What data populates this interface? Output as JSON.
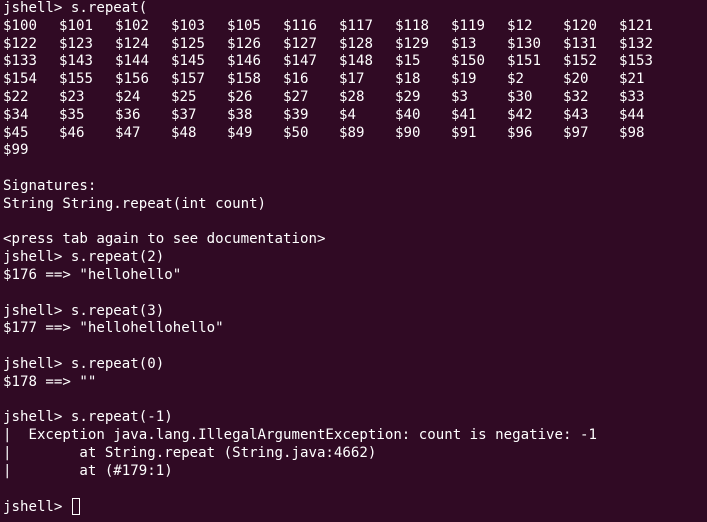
{
  "terminal": {
    "prompt_line": "jshell> s.repeat(",
    "completions": [
      [
        "$100",
        "$101",
        "$102",
        "$103",
        "$105",
        "$116",
        "$117",
        "$118",
        "$119",
        "$12",
        "$120",
        "$121"
      ],
      [
        "$122",
        "$123",
        "$124",
        "$125",
        "$126",
        "$127",
        "$128",
        "$129",
        "$13",
        "$130",
        "$131",
        "$132"
      ],
      [
        "$133",
        "$143",
        "$144",
        "$145",
        "$146",
        "$147",
        "$148",
        "$15",
        "$150",
        "$151",
        "$152",
        "$153"
      ],
      [
        "$154",
        "$155",
        "$156",
        "$157",
        "$158",
        "$16",
        "$17",
        "$18",
        "$19",
        "$2",
        "$20",
        "$21"
      ],
      [
        "$22",
        "$23",
        "$24",
        "$25",
        "$26",
        "$27",
        "$28",
        "$29",
        "$3",
        "$30",
        "$32",
        "$33"
      ],
      [
        "$34",
        "$35",
        "$36",
        "$37",
        "$38",
        "$39",
        "$4",
        "$40",
        "$41",
        "$42",
        "$43",
        "$44"
      ],
      [
        "$45",
        "$46",
        "$47",
        "$48",
        "$49",
        "$50",
        "$89",
        "$90",
        "$91",
        "$96",
        "$97",
        "$98"
      ],
      [
        "$99"
      ]
    ],
    "signatures_header": "Signatures:",
    "signature": "String String.repeat(int count)",
    "press_tab_hint": "<press tab again to see documentation>",
    "cmd1": "jshell> s.repeat(2)",
    "out1": "$176 ==> \"hellohello\"",
    "cmd2": "jshell> s.repeat(3)",
    "out2": "$177 ==> \"hellohellohello\"",
    "cmd3": "jshell> s.repeat(0)",
    "out3": "$178 ==> \"\"",
    "cmd4": "jshell> s.repeat(-1)",
    "exception_line": "|  Exception java.lang.IllegalArgumentException: count is negative: -1",
    "stack1": "|        at String.repeat (String.java:4662)",
    "stack2": "|        at (#179:1)",
    "final_prompt": "jshell> "
  },
  "colors": {
    "background": "#300a24",
    "foreground": "#ffffff"
  }
}
